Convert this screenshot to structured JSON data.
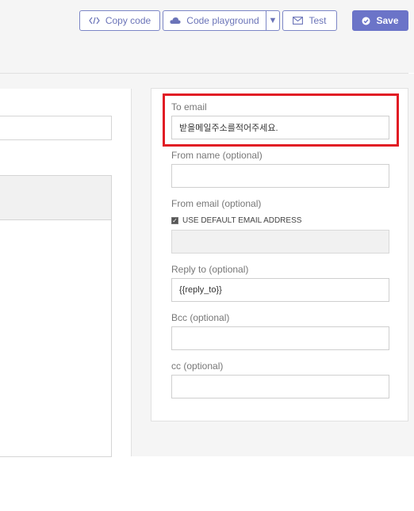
{
  "toolbar": {
    "copy_code_label": "Copy code",
    "code_playground_label": "Code playground",
    "caret": "▼",
    "test_label": "Test",
    "save_label": "Save"
  },
  "icons": {
    "copy_code": "code-icon",
    "code_playground": "cloud-icon",
    "test": "envelope-icon",
    "save": "check-circle-icon"
  },
  "form": {
    "to_email": {
      "label": "To email",
      "value": "받을메일주소를적어주세요."
    },
    "from_name": {
      "label": "From name (optional)",
      "value": ""
    },
    "from_email": {
      "label": "From email (optional)",
      "checkbox_label": "USE DEFAULT EMAIL ADDRESS",
      "checked": true,
      "value": ""
    },
    "reply_to": {
      "label": "Reply to (optional)",
      "value": "{{reply_to}}"
    },
    "bcc": {
      "label": "Bcc (optional)",
      "value": ""
    },
    "cc": {
      "label": "cc (optional)",
      "value": ""
    }
  },
  "colors": {
    "accent": "#6b74c8",
    "highlight": "#e11c24"
  }
}
